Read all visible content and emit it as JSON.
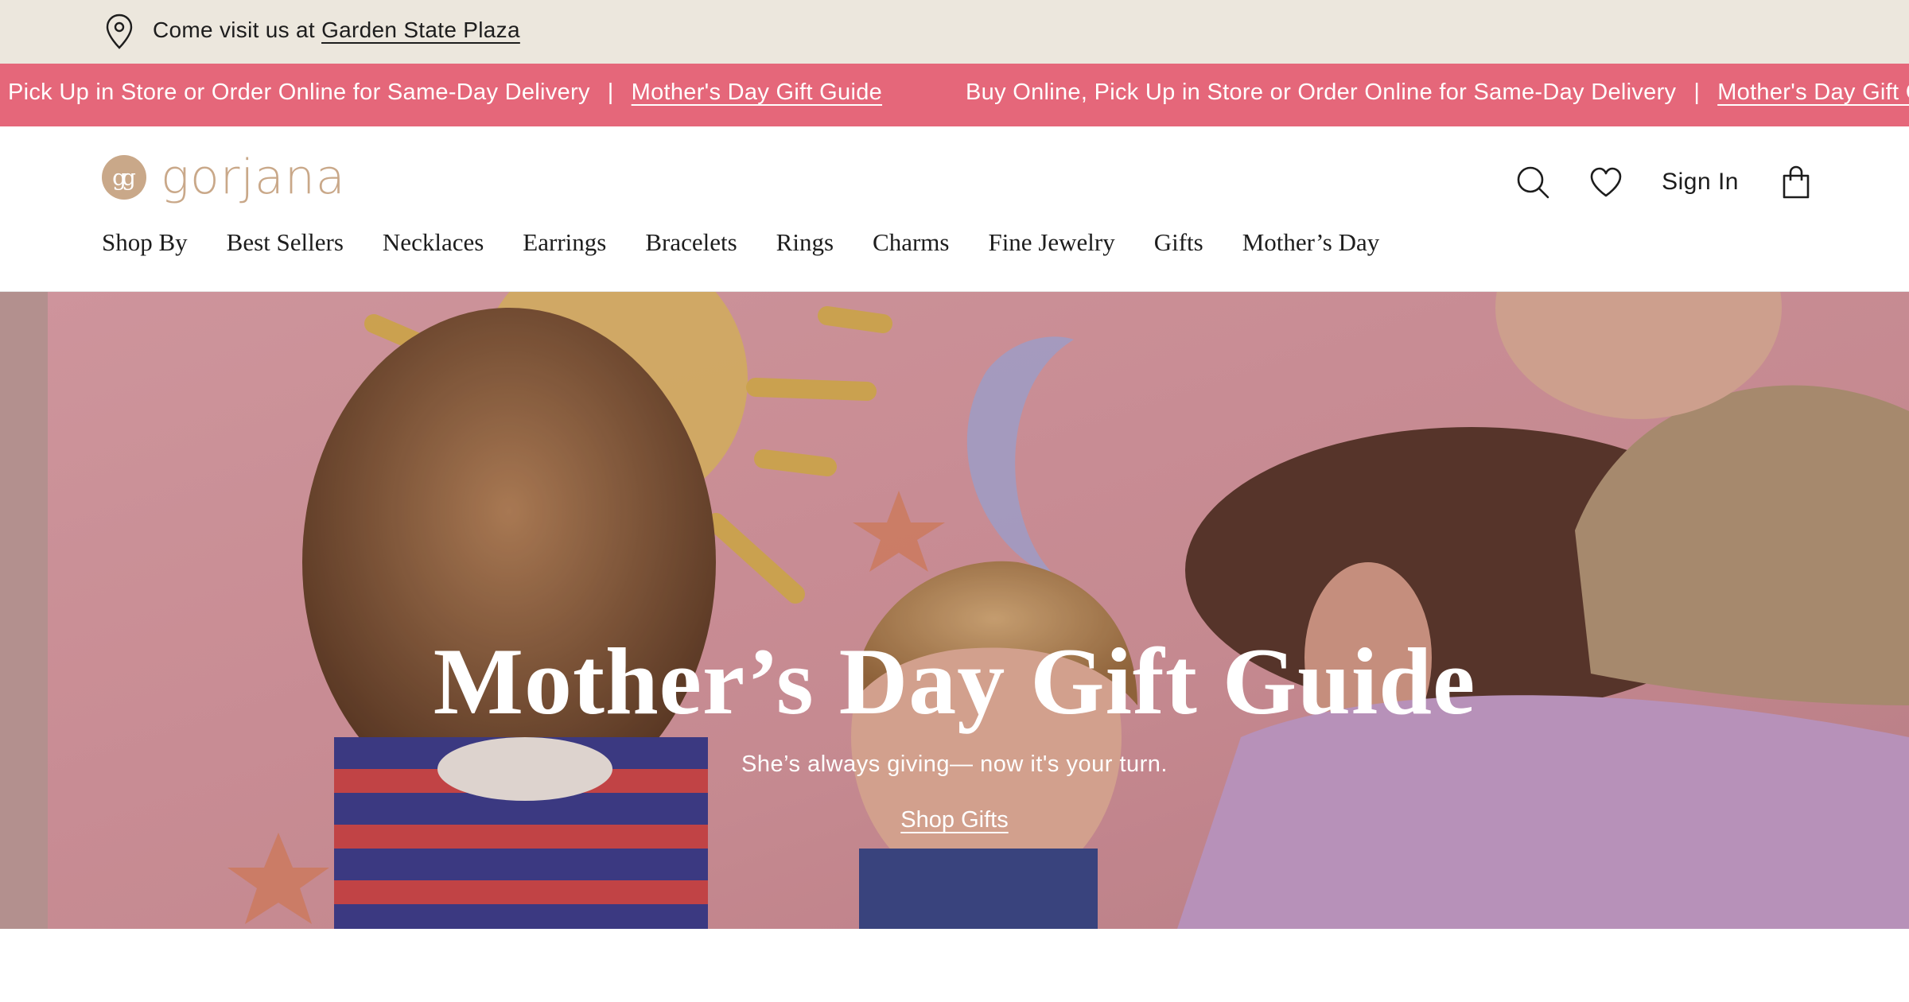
{
  "store_bar": {
    "icon": "location-pin-icon",
    "prefix": "Come visit us at ",
    "store_name": "Garden State Plaza"
  },
  "promo": {
    "segment1_text": "Pick Up in Store or Order Online for Same-Day Delivery",
    "segment1_sep": "|",
    "segment1_link": "Mother's Day Gift Guide",
    "segment2_text": "Buy Online, Pick Up in Store or Order Online for Same-Day Delivery",
    "segment2_sep": "|",
    "segment2_link": "Mother's Day Gift Guide",
    "bg_color": "#e5677a"
  },
  "header": {
    "logo_mark": "gg",
    "logo_text": "gorjana",
    "brand_color": "#c9a889",
    "icons": [
      "search-icon",
      "heart-icon",
      "shopping-bag-icon"
    ],
    "signin_label": "Sign In"
  },
  "nav": {
    "items": [
      "Shop By",
      "Best Sellers",
      "Necklaces",
      "Earrings",
      "Bracelets",
      "Rings",
      "Charms",
      "Fine Jewelry",
      "Gifts",
      "Mother’s Day"
    ]
  },
  "hero": {
    "title": "Mother’s Day Gift Guide",
    "subtitle": "She’s always giving— now it's your turn.",
    "cta": "Shop Gifts"
  }
}
